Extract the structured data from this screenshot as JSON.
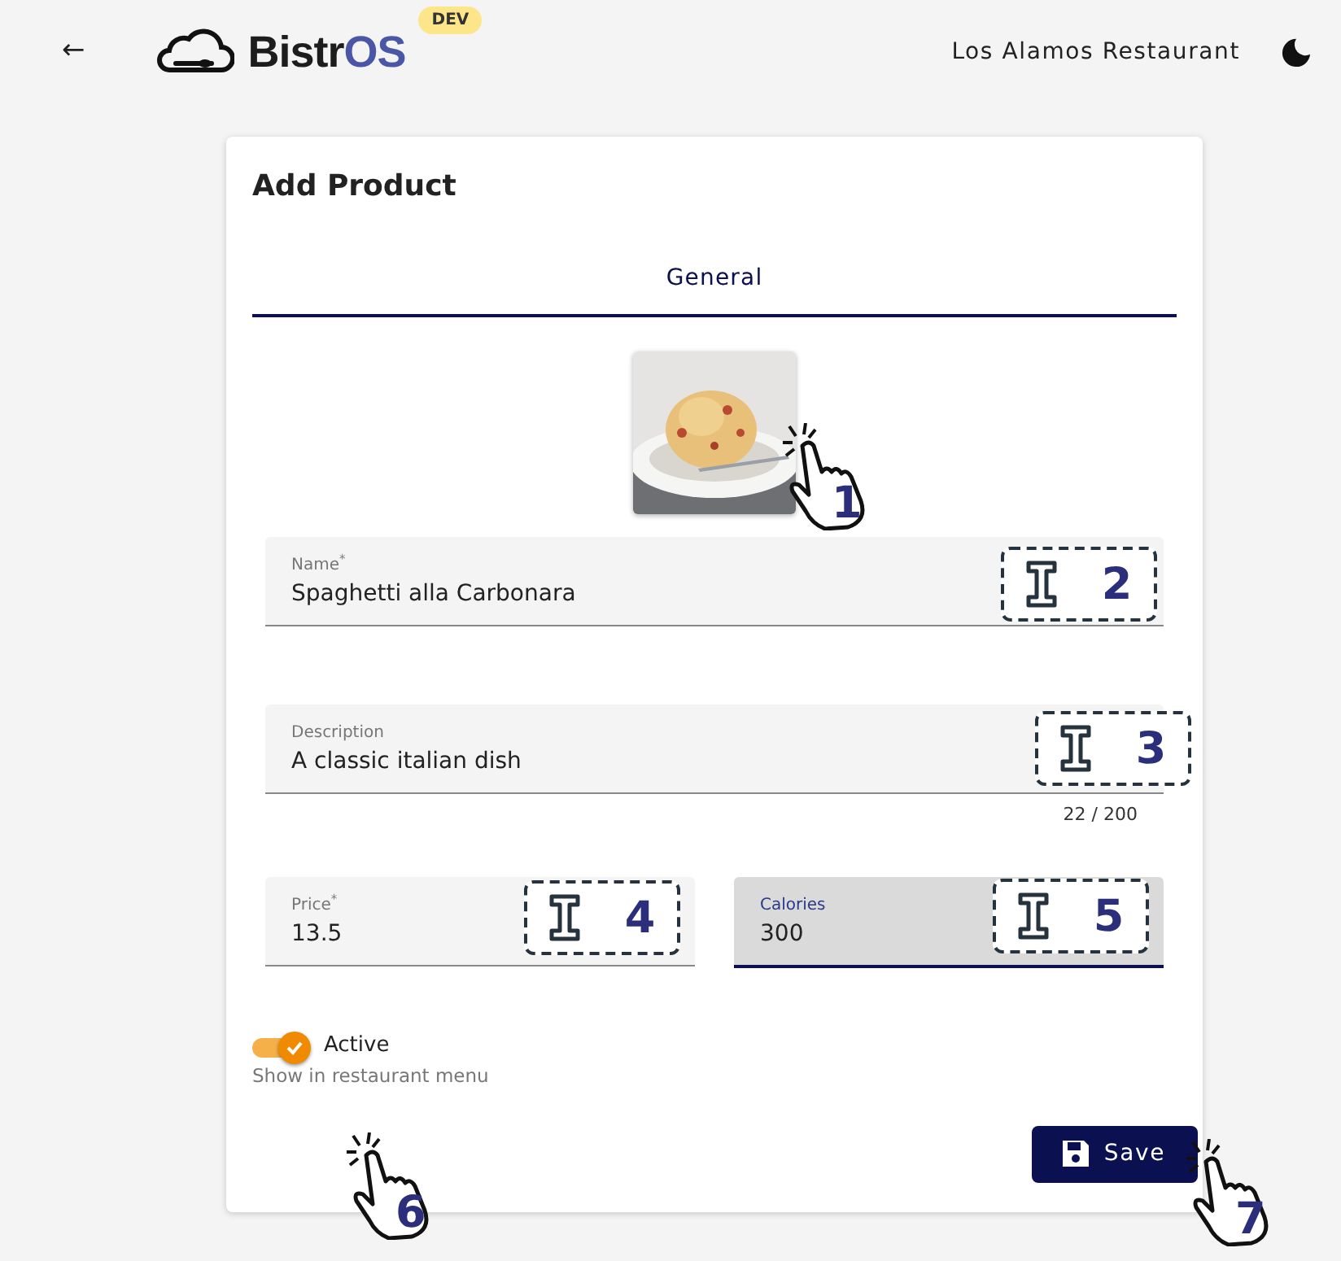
{
  "header": {
    "back_label": "←",
    "logo": {
      "part_1": "Bistr",
      "part_2": "OS"
    },
    "env_badge": "DEV",
    "restaurant": "Los Alamos Restaurant"
  },
  "card": {
    "title": "Add Product",
    "tabs": [
      {
        "label": "General",
        "selected": true
      }
    ],
    "image": {
      "kind": "picture"
    },
    "field_rows": [
      [
        {
          "label": "Name$^{*}$",
          "value": "Spaghetti alla Carbonara",
          "focused": false
        }
      ],
      [
        {
          "label": "Description",
          "value": "A classic italian dish",
          "focused": false,
          "counter": "22 / 200"
        }
      ],
      [
        {
          "label": "Price$^{*}$",
          "value": "13.5",
          "focused": false
        },
        {
          "label": "Calories",
          "value": "300",
          "focused": true
        }
      ]
    ],
    "toggle": {
      "label": "Active",
      "on": true,
      "hint": "Show in restaurant menu"
    },
    "save_button": "Save"
  },
  "markers": [
    {
      "kind": "click",
      "number": "1"
    },
    {
      "kind": "text-cursor",
      "number": "2"
    },
    {
      "kind": "text-cursor",
      "number": "3"
    },
    {
      "kind": "text-cursor",
      "number": "4"
    },
    {
      "kind": "text-cursor",
      "number": "5"
    },
    {
      "kind": "click",
      "number": "6"
    },
    {
      "kind": "click",
      "number": "7"
    }
  ]
}
